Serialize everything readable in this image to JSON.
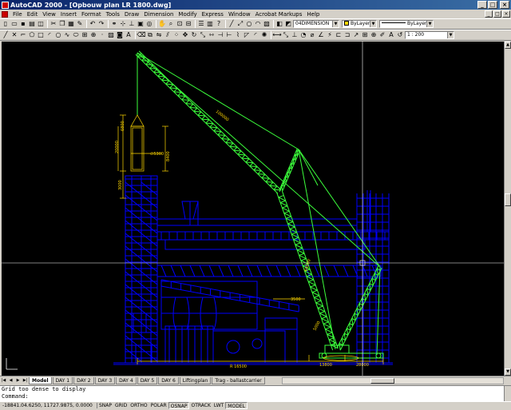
{
  "window": {
    "app_name": "AutoCAD 2000",
    "title": "AutoCAD 2000 - [Opbouw plan LR 1800.dwg]",
    "buttons": {
      "minimize": "_",
      "maximize": "□",
      "close": "×"
    }
  },
  "menubar": {
    "items": [
      "File",
      "Edit",
      "View",
      "Insert",
      "Format",
      "Tools",
      "Draw",
      "Dimension",
      "Modify",
      "Express",
      "Window",
      "Acrobat Markups",
      "Help"
    ]
  },
  "toolbar_properties": {
    "layer_combo": "04DIMENSION",
    "color_combo": "ByLayer",
    "linetype_combo": "ByLayer",
    "colors": {
      "color_swatch": "#ffd700"
    }
  },
  "toolbar_dimension": {
    "scale_combo": "1 : 200"
  },
  "drawing": {
    "colors": {
      "background": "#000000",
      "plant": "#0000ff",
      "crane": "#3cff3c",
      "dimensions": "#ffd700",
      "crosshair": "#ffffff"
    },
    "dimension_labels": [
      "100000",
      "60000",
      "20000",
      "6800",
      "∅5300",
      "3000",
      "8400",
      "3500",
      "5000",
      "R 16500",
      "13800",
      "28000"
    ]
  },
  "layout_tabs": {
    "items": [
      "Model",
      "DAY 1",
      "DAY 2",
      "DAY 3",
      "DAY 4",
      "DAY 5",
      "DAY 6",
      "Liftingplan",
      "Trag - ballastcarrier"
    ],
    "active": "Model"
  },
  "command": {
    "history": "Grid too dense to display",
    "prompt": "Command:"
  },
  "statusbar": {
    "coordinates": "-18841.04.6250, 11727.9875, 0.0000",
    "toggles": [
      {
        "label": "SNAP",
        "on": false
      },
      {
        "label": "GRID",
        "on": false
      },
      {
        "label": "ORTHO",
        "on": false
      },
      {
        "label": "POLAR",
        "on": false
      },
      {
        "label": "OSNAP",
        "on": true
      },
      {
        "label": "OTRACK",
        "on": false
      },
      {
        "label": "LWT",
        "on": false
      },
      {
        "label": "MODEL",
        "on": true
      }
    ]
  }
}
